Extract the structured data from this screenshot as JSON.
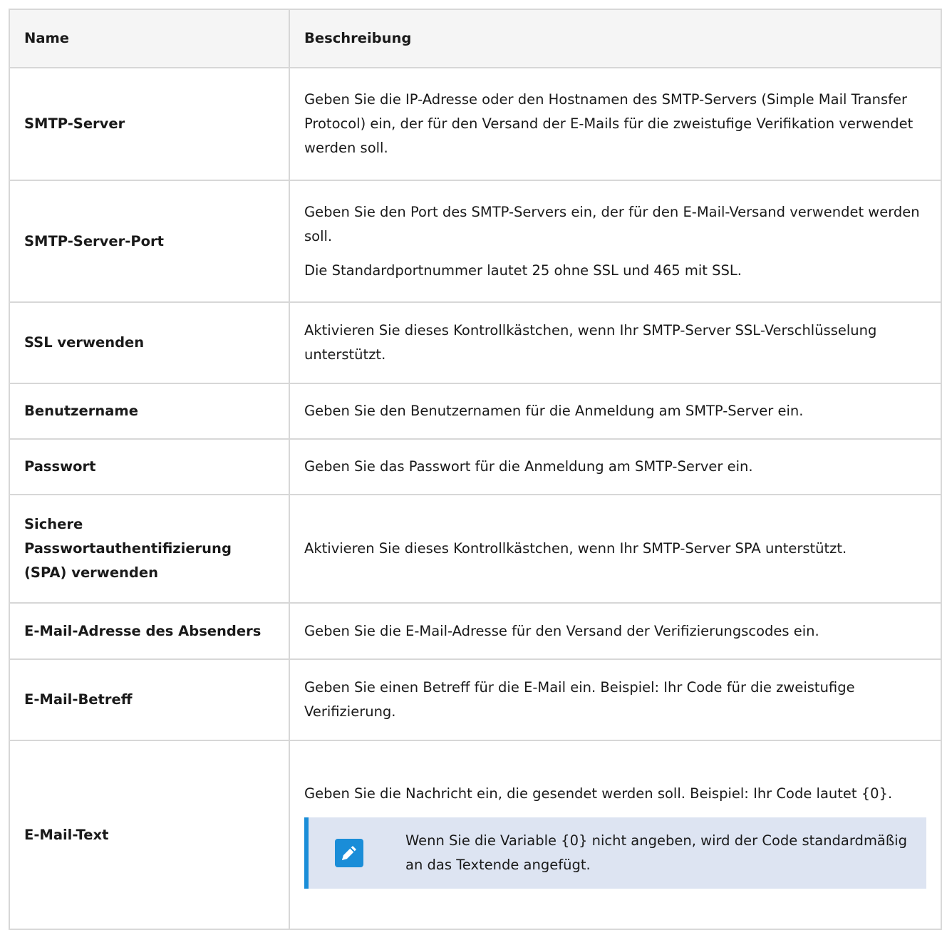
{
  "table": {
    "headers": [
      "Name",
      "Beschreibung"
    ],
    "rows": [
      {
        "name": "SMTP-Server",
        "desc": [
          "Geben Sie die IP-Adresse oder den Hostnamen des SMTP-Servers (Simple Mail Transfer Protocol) ein, der für den Versand der E-Mails für die zweistufige Verifikation verwendet werden soll."
        ]
      },
      {
        "name": "SMTP-Server-Port",
        "desc": [
          "Geben Sie den Port des SMTP-Servers ein, der für den E-Mail-Versand verwendet werden soll.",
          "Die Standardportnummer lautet 25 ohne SSL und 465 mit SSL."
        ]
      },
      {
        "name": "SSL verwenden",
        "desc": [
          "Aktivieren Sie dieses Kontrollkästchen, wenn Ihr SMTP-Server SSL-Verschlüsselung unterstützt."
        ]
      },
      {
        "name": "Benutzername",
        "desc": [
          "Geben Sie den Benutzernamen für die Anmeldung am SMTP-Server ein."
        ]
      },
      {
        "name": "Passwort",
        "desc": [
          "Geben Sie das Passwort für die Anmeldung am SMTP-Server ein."
        ]
      },
      {
        "name": "Sichere Passwortauthentifizierung (SPA) verwenden",
        "desc": [
          "Aktivieren Sie dieses Kontrollkästchen, wenn Ihr SMTP-Server SPA unterstützt."
        ]
      },
      {
        "name": "E-Mail-Adresse des Absenders",
        "desc": [
          "Geben Sie die E-Mail-Adresse für den Versand der Verifizierungscodes ein."
        ]
      },
      {
        "name": "E-Mail-Betreff",
        "desc": [
          "Geben Sie einen Betreff für die E-Mail ein. Beispiel: Ihr Code für die zweistufige Verifizierung."
        ]
      },
      {
        "name": "E-Mail-Text",
        "desc": [
          "Geben Sie die Nachricht ein, die gesendet werden soll. Beispiel: Ihr Code lautet {0}."
        ],
        "note": "Wenn Sie die Variable {0} nicht angeben, wird der Code standardmäßig an das Textende angefügt."
      }
    ]
  },
  "colors": {
    "note_bg": "#dde4f2",
    "note_accent": "#1a8dd8"
  },
  "icons": {
    "note": "pencil-icon"
  }
}
